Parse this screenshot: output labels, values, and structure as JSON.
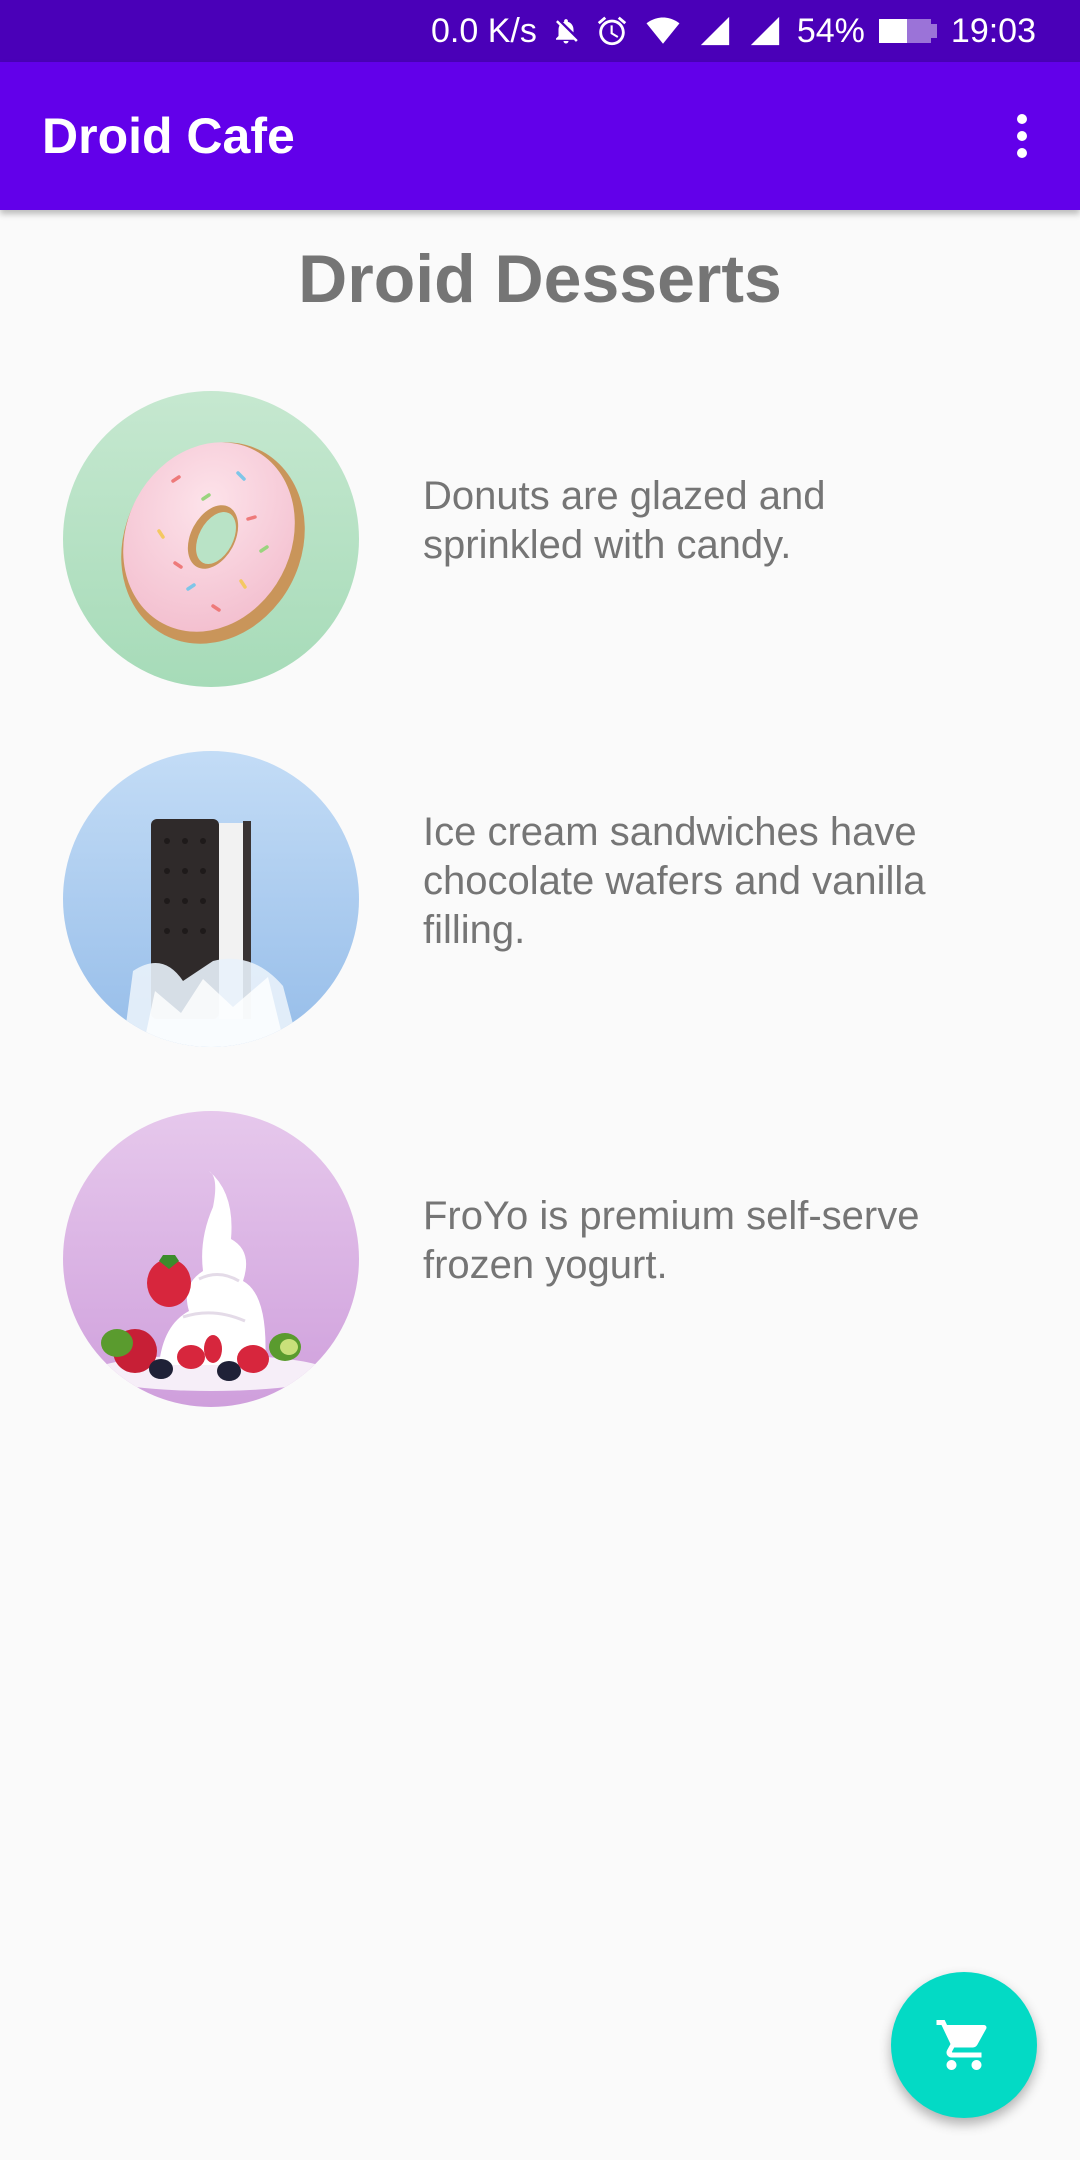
{
  "status_bar": {
    "network_speed": "0.0 K/s",
    "battery_percent": "54%",
    "battery_level": 0.54,
    "time": "19:03",
    "icons": [
      "notifications-off-icon",
      "alarm-icon",
      "wifi-icon",
      "signal-icon",
      "signal-icon",
      "battery-icon"
    ]
  },
  "app_bar": {
    "title": "Droid Cafe",
    "menu_icon": "more-vert-icon",
    "background": "#6200ea"
  },
  "main": {
    "heading": "Droid Desserts",
    "desserts": [
      {
        "name": "donut",
        "description": "Donuts are glazed and sprinkled with candy.",
        "image_icon": "donut-image"
      },
      {
        "name": "ice-cream-sandwich",
        "description": "Ice cream sandwiches have chocolate wafers and vanilla filling.",
        "image_icon": "ice-cream-sandwich-image"
      },
      {
        "name": "froyo",
        "description": "FroYo is premium self-serve frozen yogurt.",
        "image_icon": "froyo-image"
      }
    ]
  },
  "fab": {
    "icon": "shopping-cart-icon",
    "color": "#03dac5"
  }
}
